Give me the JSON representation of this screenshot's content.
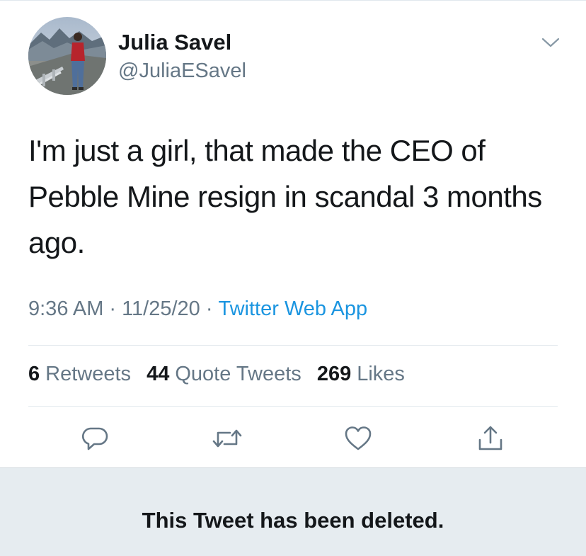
{
  "user": {
    "name": "Julia Savel",
    "handle": "@JuliaESavel"
  },
  "tweet": {
    "text": "I'm just a girl, that made the CEO of Pebble Mine resign in scandal 3 months ago.",
    "time": "9:36 AM",
    "date": "11/25/20",
    "separator": "·",
    "source": "Twitter Web App"
  },
  "stats": {
    "retweets_count": "6",
    "retweets_label": "Retweets",
    "quotes_count": "44",
    "quotes_label": "Quote Tweets",
    "likes_count": "269",
    "likes_label": "Likes"
  },
  "icons": {
    "caret": "chevron-down-icon",
    "reply": "reply-icon",
    "retweet": "retweet-icon",
    "like": "heart-icon",
    "share": "share-icon"
  },
  "colors": {
    "text": "#14171a",
    "secondary": "#657786",
    "link": "#1b95e0",
    "divider": "#e1e8ed",
    "deleted_bg": "#e6ecf0"
  },
  "notice": {
    "deleted": "This Tweet has been deleted."
  }
}
